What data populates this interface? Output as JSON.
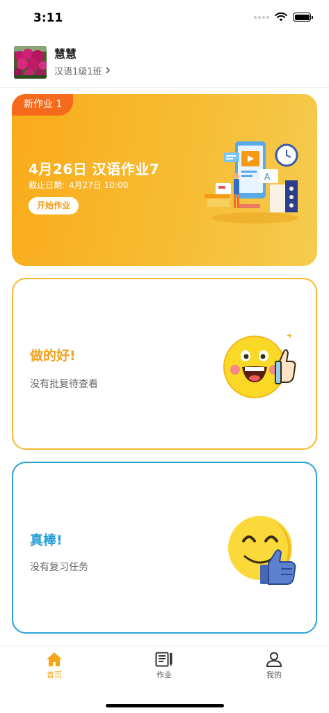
{
  "status_bar": {
    "time": "3:11"
  },
  "profile": {
    "name": "慧慧",
    "class_name": "汉语1级1班"
  },
  "homework_card": {
    "badge": "新作业 1",
    "title": "4月26日 汉语作业7",
    "deadline_label": "截止日期:",
    "deadline_value": "4月27日 10:00",
    "start_button": "开始作业"
  },
  "review_card": {
    "title": "做的好!",
    "subtitle": "没有批复待查看"
  },
  "praise_card": {
    "title": "真棒!",
    "subtitle": "没有复习任务"
  },
  "tab_bar": {
    "tabs": [
      {
        "label": "首页",
        "icon": "home-icon",
        "active": true
      },
      {
        "label": "作业",
        "icon": "homework-icon",
        "active": false
      },
      {
        "label": "我的",
        "icon": "person-icon",
        "active": false
      }
    ]
  },
  "colors": {
    "accent": "#f5a519",
    "badge": "#f56a1c",
    "review_border": "#f7b731",
    "praise_border": "#2aa2db"
  }
}
